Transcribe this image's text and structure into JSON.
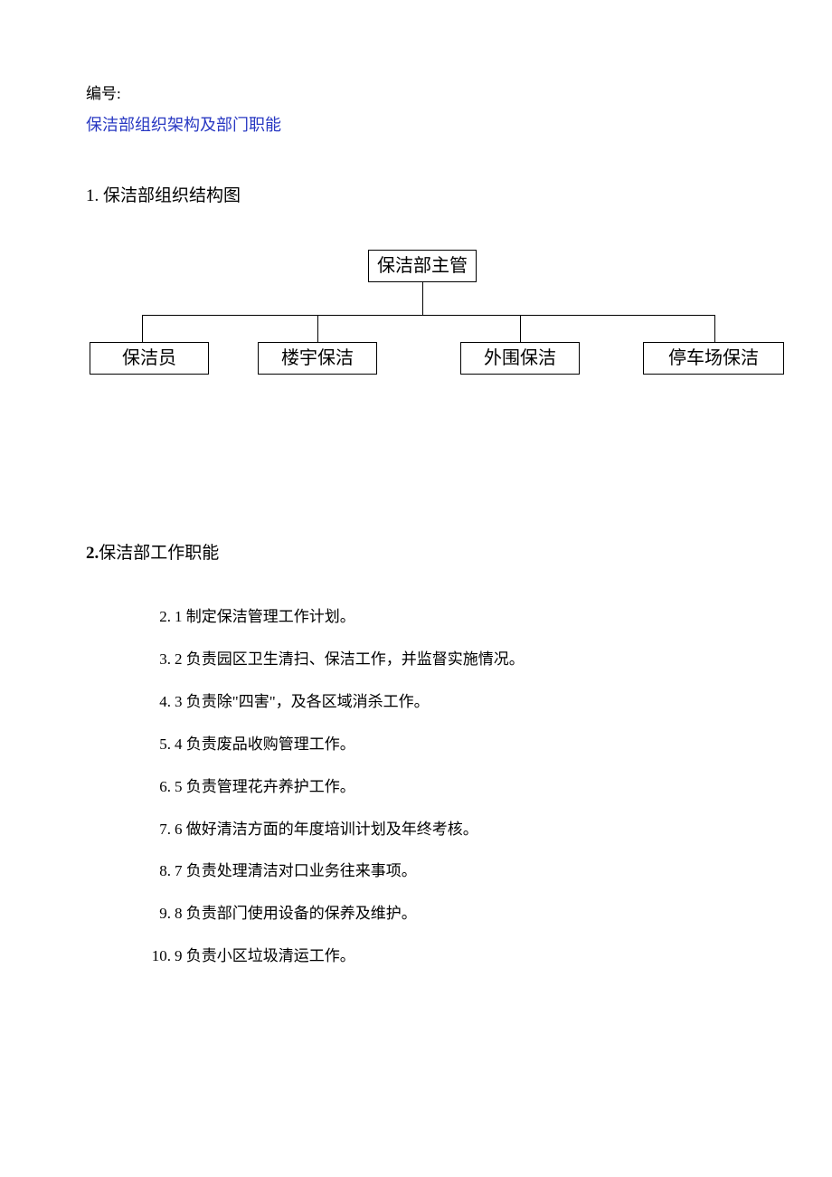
{
  "header": {
    "number_label": "编号:",
    "title": "保洁部组织架构及部门职能"
  },
  "section1": {
    "heading": "1. 保洁部组织结构图"
  },
  "chart_data": {
    "type": "org",
    "root": "保洁部主管",
    "children": [
      "保洁员",
      "楼宇保洁",
      "外围保洁",
      "停车场保洁"
    ]
  },
  "section2": {
    "heading_num": "2.",
    "heading_text": "保洁部工作职能"
  },
  "items": [
    {
      "n": "2.",
      "txt": "1 制定保洁管理工作计划。"
    },
    {
      "n": "3.",
      "txt": "2 负责园区卫生清扫、保洁工作，并监督实施情况。"
    },
    {
      "n": "4.",
      "txt": "3 负责除\"四害\"，及各区域消杀工作。"
    },
    {
      "n": "5.",
      "txt": "4 负责废品收购管理工作。"
    },
    {
      "n": "6.",
      "txt": "5 负责管理花卉养护工作。"
    },
    {
      "n": "7.",
      "txt": "6 做好清洁方面的年度培训计划及年终考核。"
    },
    {
      "n": "8.",
      "txt": "7 负责处理清洁对口业务往来事项。"
    },
    {
      "n": "9.",
      "txt": "8 负责部门使用设备的保养及维护。"
    },
    {
      "n": "10.",
      "txt": "9 负责小区垃圾清运工作。"
    }
  ]
}
